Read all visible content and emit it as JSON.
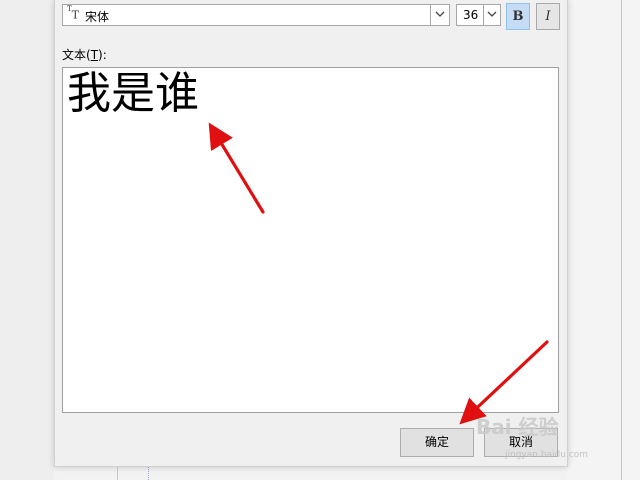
{
  "font": {
    "prefix_icon": "font-type-icon",
    "name": "宋体"
  },
  "size": {
    "value": "36"
  },
  "format": {
    "bold_label": "B",
    "italic_label": "I"
  },
  "text_label": {
    "main": "文本(",
    "mnemonic": "T",
    "tail": "):"
  },
  "text_content": "我是谁",
  "buttons": {
    "ok": "确定",
    "cancel": "取消"
  },
  "watermark": {
    "brand": "Bai 经验",
    "url": "jingyan.baidu.com"
  },
  "annotations": {
    "arrow_color": "#e01010"
  }
}
